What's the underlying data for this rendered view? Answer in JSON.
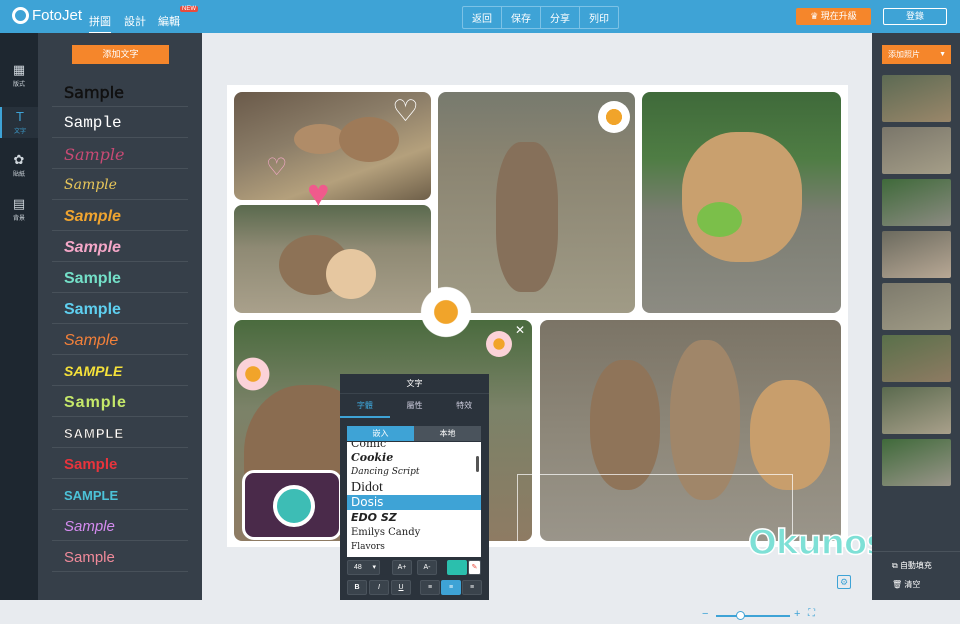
{
  "app": {
    "brand": "FotoJet",
    "nav": [
      {
        "label": "拼圖",
        "active": true
      },
      {
        "label": "設計",
        "active": false
      },
      {
        "label": "編輯",
        "active": false,
        "badge": "NEW"
      }
    ],
    "center_actions": [
      "返回",
      "保存",
      "分享",
      "列印"
    ],
    "upgrade_label": "現在升級",
    "login_label": "登錄"
  },
  "rail": {
    "items": [
      {
        "label": "版式",
        "icon": "layout-icon"
      },
      {
        "label": "文字",
        "icon": "text-icon",
        "active": true
      },
      {
        "label": "貼紙",
        "icon": "clipart-icon"
      },
      {
        "label": "背景",
        "icon": "background-icon"
      }
    ]
  },
  "text_panel": {
    "add_text_label": "添加文字",
    "samples": [
      "Sample",
      "Sample",
      "Sample",
      "Sample",
      "Sample",
      "Sample",
      "Sample",
      "Sample",
      "Sample",
      "SAMPLE",
      "Sample",
      "SAMPLE",
      "Sample",
      "SAMPLE",
      "Sample",
      "Sample"
    ]
  },
  "canvas": {
    "overlay_text": "Okunoshima"
  },
  "font_popup": {
    "title": "文字",
    "tabs": [
      "字體",
      "屬性",
      "特效"
    ],
    "subtabs": [
      "嵌入",
      "本地"
    ],
    "fonts": [
      "Comic",
      "Cookie",
      "Dancing Script",
      "Didot",
      "Dosis",
      "EDO SZ",
      "Emilys Candy",
      "Flavors"
    ],
    "selected_font": "Dosis",
    "font_size": "48",
    "size_up": "A+",
    "size_down": "A-",
    "bold": "B",
    "italic": "I",
    "underline": "U",
    "color": "#2bbfad"
  },
  "right_panel": {
    "add_photo_label": "添加照片",
    "autofill_label": "自動填充",
    "clear_label": "清空"
  },
  "colors": {
    "accent": "#3ea3d6",
    "orange": "#f5862b",
    "panel": "#363f49"
  }
}
